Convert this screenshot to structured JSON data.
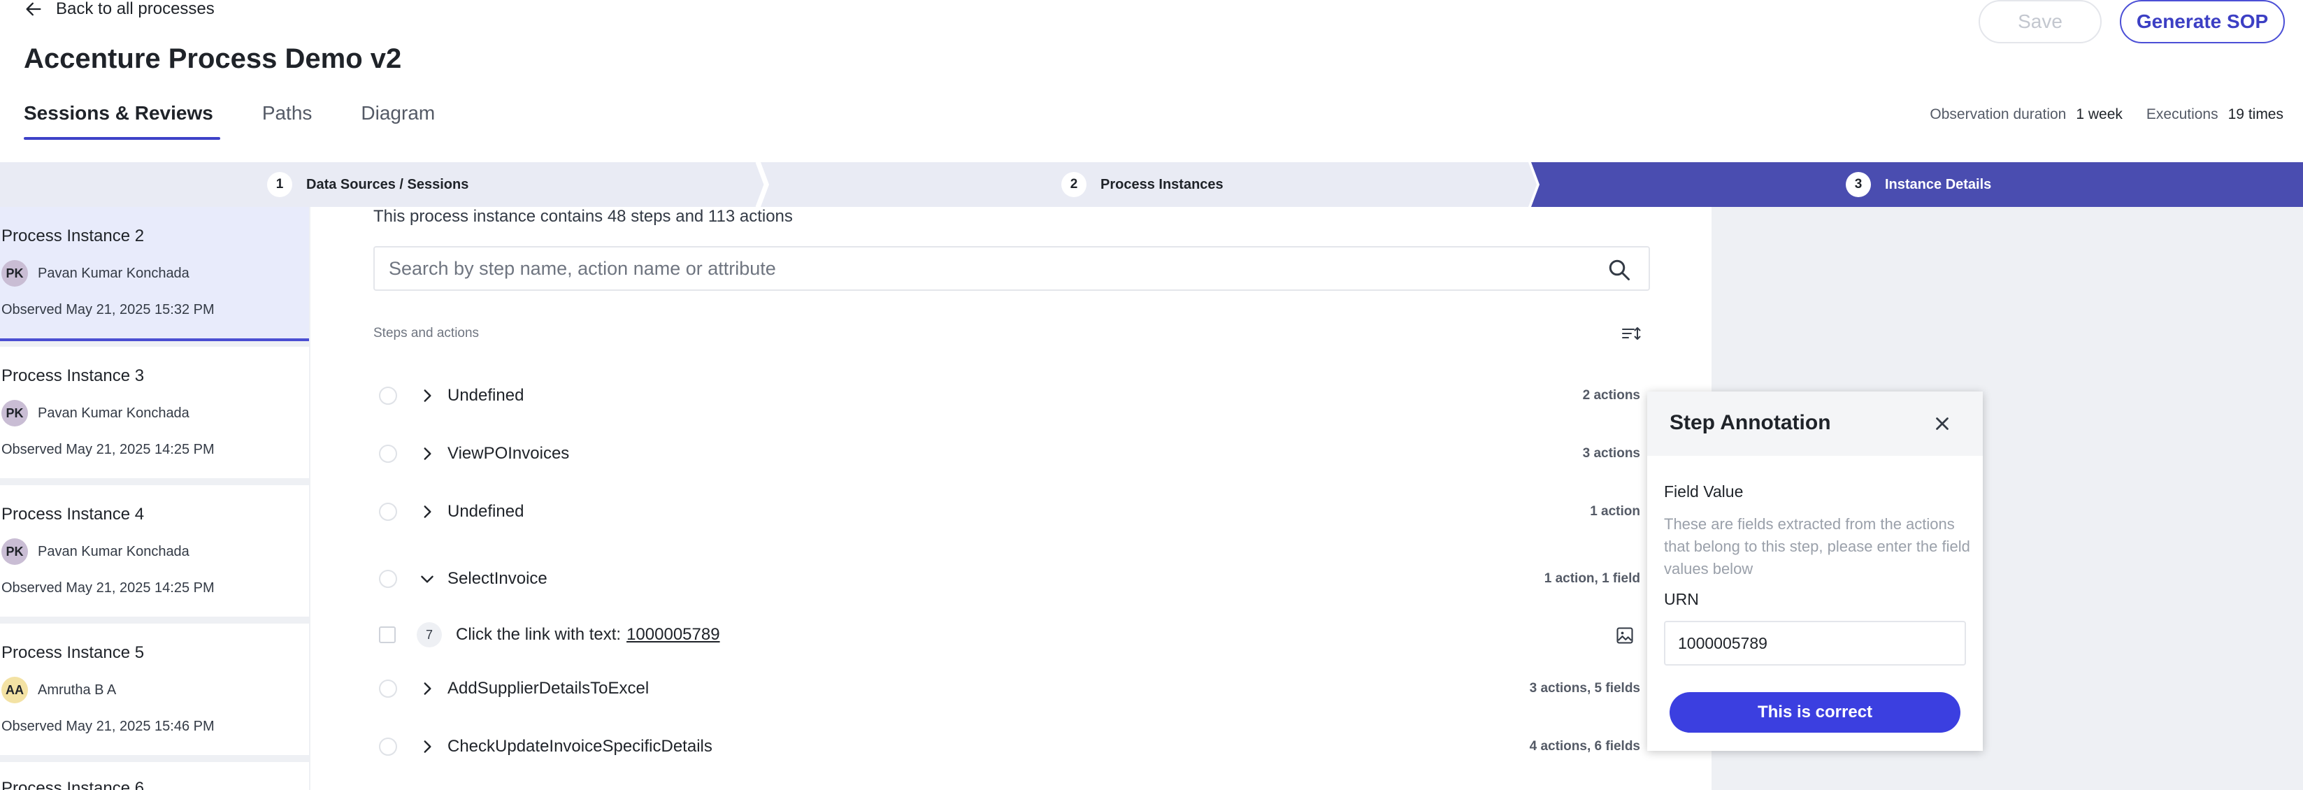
{
  "header": {
    "back_label": "Back to all processes",
    "title": "Accenture Process Demo v2",
    "save_label": "Save",
    "generate_sop_label": "Generate SOP"
  },
  "tabs": [
    {
      "label": "Sessions & Reviews",
      "active": true
    },
    {
      "label": "Paths",
      "active": false
    },
    {
      "label": "Diagram",
      "active": false
    }
  ],
  "stats": {
    "observation_label": "Observation duration",
    "observation_value": "1 week",
    "executions_label": "Executions",
    "executions_value": "19 times"
  },
  "stepper": [
    {
      "num": "1",
      "label": "Data Sources / Sessions"
    },
    {
      "num": "2",
      "label": "Process Instances"
    },
    {
      "num": "3",
      "label": "Instance Details",
      "active": true
    }
  ],
  "instances": [
    {
      "title": "Process Instance 2",
      "initials": "PK",
      "user": "Pavan Kumar Konchada",
      "observed": "Observed May 21, 2025 15:32 PM",
      "selected": true
    },
    {
      "title": "Process Instance 3",
      "initials": "PK",
      "user": "Pavan Kumar Konchada",
      "observed": "Observed May 21, 2025 14:25 PM"
    },
    {
      "title": "Process Instance 4",
      "initials": "PK",
      "user": "Pavan Kumar Konchada",
      "observed": "Observed May 21, 2025 14:25 PM"
    },
    {
      "title": "Process Instance 5",
      "initials": "AA",
      "user": "Amrutha B A",
      "observed": "Observed May 21, 2025 15:46 PM"
    },
    {
      "title": "Process Instance 6"
    }
  ],
  "main": {
    "summary": "This process instance contains 48 steps and 113 actions",
    "search_placeholder": "Search by step name, action name or attribute",
    "section_label": "Steps and actions",
    "steps": [
      {
        "name": "Undefined",
        "count": "2 actions"
      },
      {
        "name": "ViewPOInvoices",
        "count": "3 actions"
      },
      {
        "name": "Undefined",
        "count": "1 action"
      },
      {
        "name": "SelectInvoice",
        "count": "1 action, 1 field",
        "expanded": true
      },
      {
        "name": "AddSupplierDetailsToExcel",
        "count": "3 actions, 5 fields"
      },
      {
        "name": "CheckUpdateInvoiceSpecificDetails",
        "count": "4 actions, 6 fields"
      }
    ],
    "action": {
      "num": "7",
      "text": "Click the link with text:",
      "link": "1000005789"
    }
  },
  "annotation": {
    "title": "Step Annotation",
    "field_label": "Field Value",
    "help": "These are fields extracted from the actions that belong to this step, please enter the field values below",
    "urn_label": "URN",
    "urn_value": "1000005789",
    "confirm_label": "This is correct"
  },
  "colors": {
    "accent": "#3e42c8",
    "stepper_active": "#4a4db0",
    "stepper_inactive": "#e9ebf4",
    "button_primary": "#3b3fe0"
  }
}
